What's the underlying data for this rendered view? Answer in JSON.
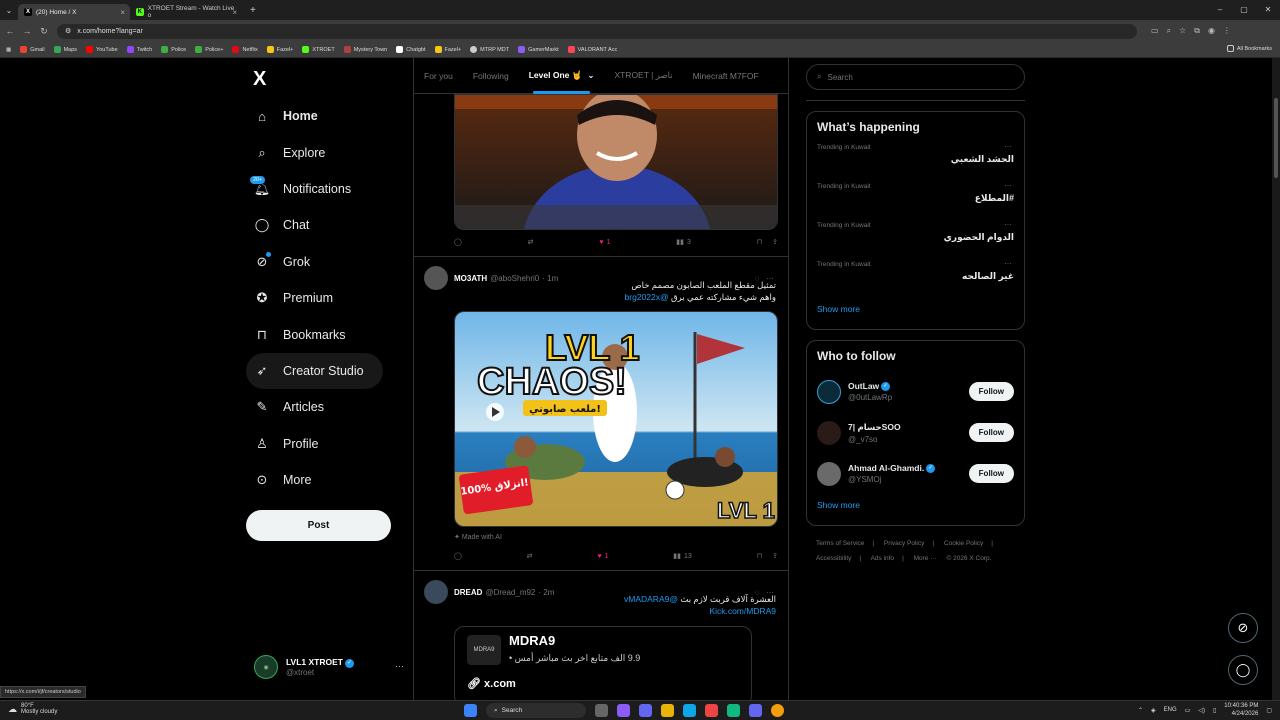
{
  "browser": {
    "tabs": [
      {
        "label": "(20) Home / X",
        "favicon": "X"
      },
      {
        "label": "XTROET Stream - Watch Live o",
        "favicon": "K"
      }
    ],
    "url": "x.com/home?lang=ar",
    "bookmarks": [
      {
        "label": "Gmail",
        "color": "#ea4335"
      },
      {
        "label": "Maps",
        "color": "#34a853"
      },
      {
        "label": "YouTube",
        "color": "#ff0000"
      },
      {
        "label": "Twitch",
        "color": "#9146ff"
      },
      {
        "label": "Police",
        "color": "#3cb043"
      },
      {
        "label": "Police+",
        "color": "#3cb043"
      },
      {
        "label": "Netflix",
        "color": "#e50914"
      },
      {
        "label": "Fazel+",
        "color": "#f5c518"
      },
      {
        "label": "XTROET",
        "color": "#53fc18"
      },
      {
        "label": "Mystery Town",
        "color": "#b04040"
      },
      {
        "label": "Chatgbt",
        "color": "#ffffff"
      },
      {
        "label": "Fazel+",
        "color": "#f5c518"
      },
      {
        "label": "MTRP MDT",
        "color": "#cccccc"
      },
      {
        "label": "GamerMarkt",
        "color": "#8b5cf6"
      },
      {
        "label": "VALORANT Acc",
        "color": "#ff4655"
      }
    ],
    "all_bookmarks": "All Bookmarks",
    "status_url": "https://x.com/i/jf/creators/studio"
  },
  "sidebar": {
    "logo": "X",
    "items": [
      {
        "label": "Home",
        "icon": "home-icon",
        "glyph": "⌂"
      },
      {
        "label": "Explore",
        "icon": "search-icon",
        "glyph": "⌕"
      },
      {
        "label": "Notifications",
        "icon": "bell-icon",
        "glyph": "♫",
        "badge": "20+"
      },
      {
        "label": "Chat",
        "icon": "chat-icon",
        "glyph": "◯"
      },
      {
        "label": "Grok",
        "icon": "grok-icon",
        "glyph": "⊘"
      },
      {
        "label": "Premium",
        "icon": "premium-icon",
        "glyph": "✪"
      },
      {
        "label": "Bookmarks",
        "icon": "bookmark-icon",
        "glyph": "⊓"
      },
      {
        "label": "Creator Studio",
        "icon": "rocket-icon",
        "glyph": "➶"
      },
      {
        "label": "Articles",
        "icon": "article-icon",
        "glyph": "✎"
      },
      {
        "label": "Profile",
        "icon": "person-icon",
        "glyph": "♙"
      },
      {
        "label": "More",
        "icon": "more-icon",
        "glyph": "⋯"
      }
    ],
    "post_label": "Post",
    "account": {
      "name": "LVL1 XTROET",
      "handle": "@xtroet"
    }
  },
  "feed": {
    "tabs": [
      "For you",
      "Following",
      "Level One 🤘",
      "XTROET | ناصر",
      "Minecraft M7FOF"
    ],
    "tweet1_actions": {
      "likes": "1",
      "views": "3"
    },
    "tweet2": {
      "name": "MO3ATH",
      "handle": "@aboShehri0",
      "time": "· 1m",
      "text_line1": "تمثيل مقطع الملعب الصابون مصمم خاص",
      "text_line2": "واهم شيء مشاركته عمي برق",
      "mention": "@brg2022x",
      "image_title": "LVL 1 CHAOS!",
      "image_subtitle": "ملعب صابوني!",
      "image_badge": "100% انزلاق!",
      "image_corner": "LVL 1",
      "made_with_ai": "Made with AI",
      "likes": "1",
      "views": "13"
    },
    "tweet3": {
      "name": "DREAD",
      "handle": "@Dread_m92",
      "time": "· 2m",
      "text": "العشرة آلاف قربت لازم بث",
      "mention": "@vMADARA9",
      "link": "Kick.com/MDRA9",
      "card_title": "MDRA9",
      "card_sub": "9.9 الف متابع اخر بث مباشر أمس •",
      "card_domain": "x.com"
    }
  },
  "right": {
    "search_placeholder": "Search",
    "happening_title": "What’s happening",
    "trends": [
      {
        "meta": "Trending in Kuwait",
        "term": "الحشد الشعبي"
      },
      {
        "meta": "Trending in Kuwait",
        "term": "#المطلاع"
      },
      {
        "meta": "Trending in Kuwait",
        "term": "الدوام الحضوري"
      },
      {
        "meta": "Trending in Kuwait",
        "term": "غير الصالحه"
      }
    ],
    "show_more": "Show more",
    "who_title": "Who to follow",
    "who": [
      {
        "name": "OutLaw",
        "handle": "@0utLawRp",
        "verified": true
      },
      {
        "name": "7| حسامSOO",
        "handle": "@_v7so",
        "verified": false
      },
      {
        "name": "Ahmad Al-Ghamdi.",
        "handle": "@YSMOj",
        "verified": true
      }
    ],
    "follow_label": "Follow",
    "footer": [
      "Terms of Service",
      "|",
      "Privacy Policy",
      "|",
      "Cookie Policy",
      "|",
      "Accessibility",
      "|",
      "Ads info",
      "|",
      "More ···",
      "© 2026 X Corp."
    ]
  },
  "taskbar": {
    "weather_temp": "80°F",
    "weather_desc": "Mostly cloudy",
    "search": "Search",
    "time": "10:40:36 PM",
    "date": "4/24/2026",
    "lang": "ENG"
  },
  "colors": {
    "accent": "#1d9bf0",
    "like": "#f91880",
    "bg": "#000000"
  }
}
